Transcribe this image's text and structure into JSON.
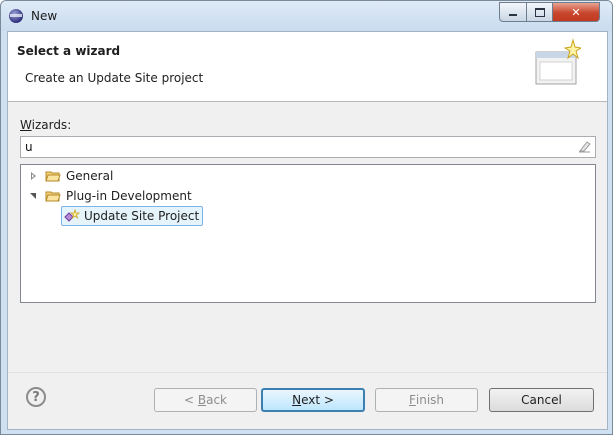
{
  "window": {
    "title": "New"
  },
  "header": {
    "title": "Select a wizard",
    "description": "Create an Update Site project"
  },
  "wizards": {
    "label_mnemonic": "W",
    "label_rest": "izards:",
    "filter_value": "u",
    "tree": [
      {
        "label": "General",
        "expanded": false
      },
      {
        "label": "Plug-in Development",
        "expanded": true
      },
      {
        "label": "Update Site Project",
        "selected": true
      }
    ]
  },
  "buttons": {
    "back_prefix": "< ",
    "back_mnemonic": "B",
    "back_rest": "ack",
    "next_mnemonic": "N",
    "next_rest": "ext >",
    "finish_mnemonic": "F",
    "finish_rest": "inish",
    "cancel": "Cancel",
    "help": "?"
  },
  "colors": {
    "default_button_border": "#3c7fb1",
    "close_button": "#c7462d"
  }
}
